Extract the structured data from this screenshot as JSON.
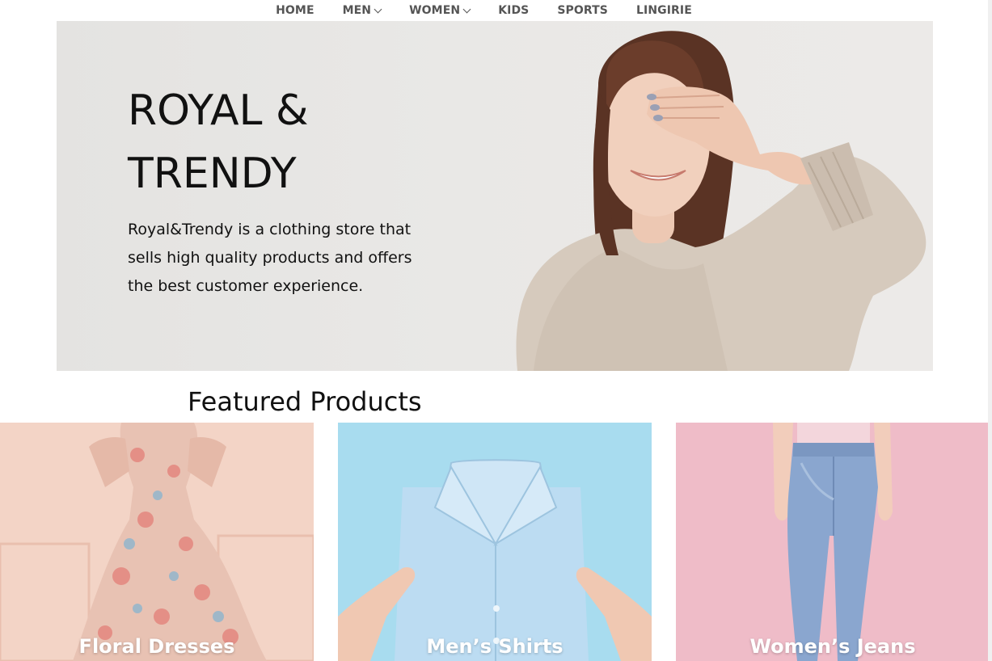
{
  "nav": {
    "items": [
      {
        "label": "HOME",
        "has_dropdown": false
      },
      {
        "label": "MEN",
        "has_dropdown": true
      },
      {
        "label": "WOMEN",
        "has_dropdown": true
      },
      {
        "label": "KIDS",
        "has_dropdown": false
      },
      {
        "label": "SPORTS",
        "has_dropdown": false
      },
      {
        "label": "LINGIRIE",
        "has_dropdown": false
      }
    ]
  },
  "hero": {
    "title": "ROYAL & TRENDY",
    "description": "Royal&Trendy is a clothing store that sells high quality products and offers the best customer experience."
  },
  "featured": {
    "heading": "Featured Products",
    "cards": [
      {
        "label": "Floral Dresses",
        "bg": "#f4d7cb"
      },
      {
        "label": "Men’s Shirts",
        "bg": "#a9dcef"
      },
      {
        "label": "Women’s Jeans",
        "bg": "#efbcc9"
      }
    ]
  },
  "colors": {
    "nav_text": "#555555",
    "hero_bg": "#e7e6e4",
    "text": "#111111"
  }
}
